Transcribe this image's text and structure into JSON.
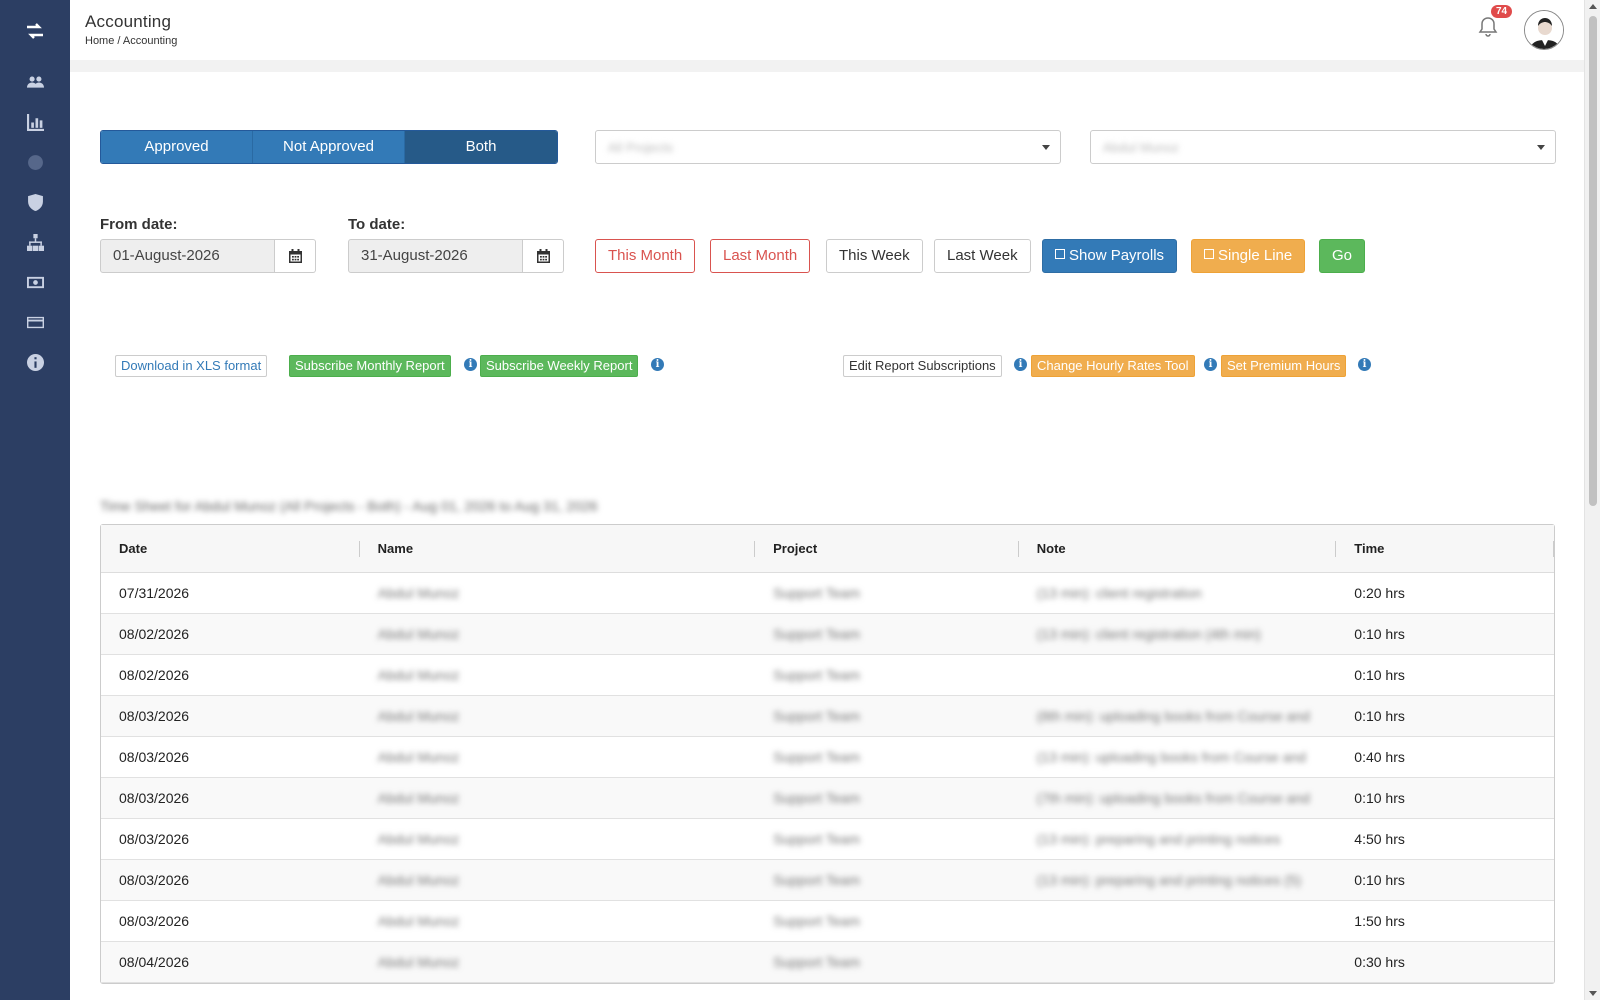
{
  "header": {
    "title": "Accounting",
    "breadcrumb": "Home / Accounting",
    "notification_count": "74"
  },
  "sidebar": {
    "items": [
      {
        "icon": "users-icon"
      },
      {
        "icon": "bar-chart-icon"
      },
      {
        "icon": "globe-icon"
      },
      {
        "icon": "shield-icon"
      },
      {
        "icon": "sitemap-icon"
      },
      {
        "icon": "money-icon"
      },
      {
        "icon": "credit-card-icon"
      },
      {
        "icon": "info-icon"
      }
    ]
  },
  "filters": {
    "approval": [
      "Approved",
      "Not Approved",
      "Both"
    ],
    "approval_selected": "Both",
    "project_select": "All Projects",
    "user_select": "Abdul Munoz"
  },
  "dates": {
    "from_label": "From date:",
    "from_value": "01-August-2026",
    "to_label": "To date:",
    "to_value": "31-August-2026"
  },
  "quick": {
    "this_month": "This Month",
    "last_month": "Last Month",
    "this_week": "This Week",
    "last_week": "Last Week",
    "show_payrolls": "Show Payrolls",
    "single_line": "Single Line",
    "go": "Go"
  },
  "actions": {
    "download_xls": "Download in XLS format",
    "subscribe_monthly": "Subscribe Monthly Report",
    "subscribe_weekly": "Subscribe Weekly Report",
    "edit_subscriptions": "Edit Report Subscriptions",
    "change_rates": "Change Hourly Rates Tool",
    "premium_hours": "Set Premium Hours"
  },
  "report_title": "Time Sheet for Abdul Munoz (All Projects - Both) - Aug 01, 2026 to Aug 31, 2026",
  "table": {
    "columns": [
      "Date",
      "Name",
      "Project",
      "Note",
      "Time"
    ],
    "rows": [
      {
        "date": "07/31/2026",
        "name": "Abdul Munoz",
        "project": "Support Team",
        "note": "(13 min): client registration",
        "time": "0:20 hrs"
      },
      {
        "date": "08/02/2026",
        "name": "Abdul Munoz",
        "project": "Support Team",
        "note": "(13 min): client registration (4th min)",
        "time": "0:10 hrs"
      },
      {
        "date": "08/02/2026",
        "name": "Abdul Munoz",
        "project": "Support Team",
        "note": "",
        "time": "0:10 hrs"
      },
      {
        "date": "08/03/2026",
        "name": "Abdul Munoz",
        "project": "Support Team",
        "note": "(8th min): uploading books from Course and",
        "time": "0:10 hrs"
      },
      {
        "date": "08/03/2026",
        "name": "Abdul Munoz",
        "project": "Support Team",
        "note": "(13 min): uploading books from Course and",
        "time": "0:40 hrs"
      },
      {
        "date": "08/03/2026",
        "name": "Abdul Munoz",
        "project": "Support Team",
        "note": "(7th min): uploading books from Course and",
        "time": "0:10 hrs"
      },
      {
        "date": "08/03/2026",
        "name": "Abdul Munoz",
        "project": "Support Team",
        "note": "(13 min): preparing and printing notices",
        "time": "4:50 hrs"
      },
      {
        "date": "08/03/2026",
        "name": "Abdul Munoz",
        "project": "Support Team",
        "note": "(13 min): preparing and printing notices (5)",
        "time": "0:10 hrs"
      },
      {
        "date": "08/03/2026",
        "name": "Abdul Munoz",
        "project": "Support Team",
        "note": "",
        "time": "1:50 hrs"
      },
      {
        "date": "08/04/2026",
        "name": "Abdul Munoz",
        "project": "Support Team",
        "note": "",
        "time": "0:30 hrs"
      }
    ]
  }
}
